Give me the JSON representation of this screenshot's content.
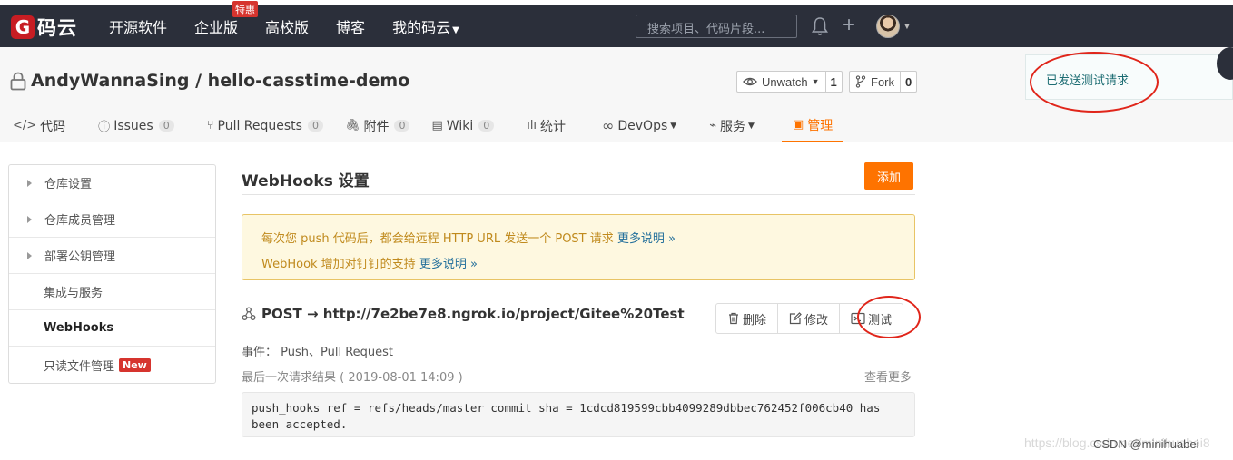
{
  "nav": {
    "logo_letter": "G",
    "logo_text": "码云",
    "links": [
      "开源软件",
      "企业版",
      "高校版",
      "博客",
      "我的码云"
    ],
    "hot_badge": "特惠",
    "search_placeholder": "搜索项目、代码片段..."
  },
  "repo": {
    "title": "AndyWannaSing / hello-casstime-demo",
    "watch_label": "Unwatch",
    "watch_count": "1",
    "fork_label": "Fork",
    "fork_count": "0"
  },
  "tabs": [
    {
      "label": "代码"
    },
    {
      "label": "Issues",
      "count": "0"
    },
    {
      "label": "Pull Requests",
      "count": "0"
    },
    {
      "label": "附件",
      "count": "0"
    },
    {
      "label": "Wiki",
      "count": "0"
    },
    {
      "label": "统计"
    },
    {
      "label": "DevOps"
    },
    {
      "label": "服务"
    },
    {
      "label": "管理"
    }
  ],
  "notice": "已发送测试请求",
  "sidebar": {
    "items": [
      {
        "label": "仓库设置"
      },
      {
        "label": "仓库成员管理"
      },
      {
        "label": "部署公钥管理"
      },
      {
        "label": "集成与服务"
      },
      {
        "label": "WebHooks"
      },
      {
        "label": "只读文件管理",
        "badge": "New"
      }
    ]
  },
  "main": {
    "title": "WebHooks 设置",
    "add_label": "添加",
    "tip_line1": "每次您 push 代码后，都会给远程 HTTP URL 发送一个 POST 请求",
    "tip_line2": "WebHook 增加对钉钉的支持",
    "tip_more": "更多说明 »",
    "hook_url": "POST → http://7e2be7e8.ngrok.io/project/Gitee%20Test",
    "delete_label": "删除",
    "edit_label": "修改",
    "test_label": "测试",
    "events": "事件：  Push、Pull Request",
    "last_result": "最后一次请求结果 ( 2019-08-01 14:09 )",
    "view_more": "查看更多",
    "result_text": "push_hooks ref = refs/heads/master commit sha = 1cdcd819599cbb4099289dbbec762452f006cb40 has been accepted."
  },
  "watermark": "https://blog.csdn.net/minihuabei8",
  "watermark_label": "CSDN @minihuabei",
  "colors": {
    "accent": "#fe7300",
    "nav_bg": "#2b2f3a",
    "tip_bg": "#fef8e0",
    "highlight": "#e0251a"
  }
}
